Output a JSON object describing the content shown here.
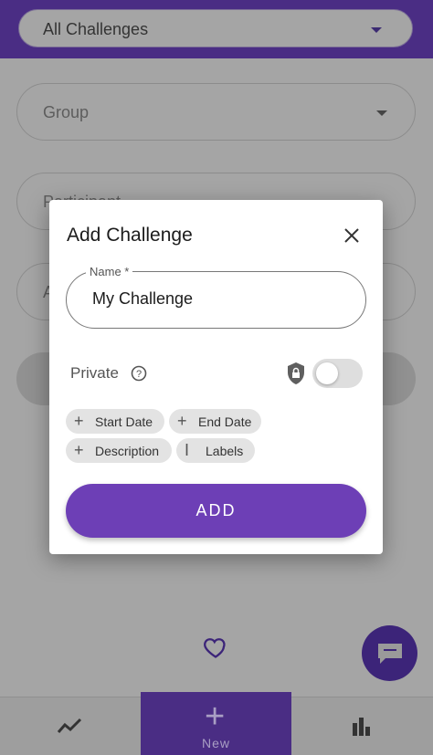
{
  "header": {
    "filter_label": "All Challenges"
  },
  "background": {
    "group_label": "Group",
    "participant_label": "Participant",
    "partial_field_label": "A"
  },
  "dialog": {
    "title": "Add Challenge",
    "name_label": "Name *",
    "name_value": "My Challenge",
    "private_label": "Private",
    "chips": [
      {
        "label": "Start Date",
        "icon": "plus-icon"
      },
      {
        "label": "End Date",
        "icon": "plus-icon"
      },
      {
        "label": "Description",
        "icon": "plus-icon"
      },
      {
        "label": "Labels",
        "icon": "text-cursor-icon"
      }
    ],
    "add_label": "ADD",
    "private_enabled": false
  },
  "bottom_nav": {
    "new_label": "New"
  },
  "colors": {
    "primary": "#4a2d84",
    "accent": "#6d3fb6",
    "overlay": "#a5a5a5"
  }
}
